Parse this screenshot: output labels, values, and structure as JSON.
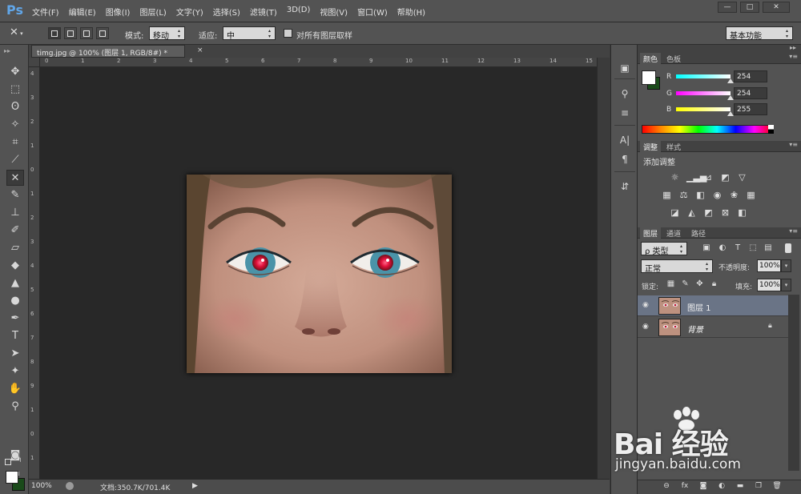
{
  "app": {
    "logo": "Ps",
    "menu": [
      "文件(F)",
      "编辑(E)",
      "图像(I)",
      "图层(L)",
      "文字(Y)",
      "选择(S)",
      "滤镜(T)",
      "3D(D)",
      "视图(V)",
      "窗口(W)",
      "帮助(H)"
    ],
    "window_controls": [
      "—",
      "□",
      "✕"
    ]
  },
  "options": {
    "mode_label": "模式:",
    "mode_value": "移动",
    "adapt_label": "适应:",
    "adapt_value": "中",
    "sample_all_label": "对所有图层取样",
    "workspace": "基本功能"
  },
  "document": {
    "tab_title": "timg.jpg @ 100% (图层 1, RGB/8#) *",
    "tab_close": "×",
    "zoom": "100%",
    "doc_info": "文档:350.7K/701.4K"
  },
  "rulers": {
    "h_ticks": [
      "0",
      "1",
      "2",
      "3",
      "4",
      "5",
      "6",
      "7",
      "8",
      "9",
      "10",
      "11",
      "12",
      "13",
      "14",
      "15"
    ],
    "v_ticks": [
      "4",
      "3",
      "2",
      "1",
      "0",
      "1",
      "2",
      "3",
      "4",
      "5",
      "6",
      "7",
      "8",
      "9",
      "1",
      "0",
      "1"
    ]
  },
  "tools": [
    {
      "name": "move-tool-icon",
      "glyph": "✥"
    },
    {
      "name": "marquee-tool-icon",
      "glyph": "⬚"
    },
    {
      "name": "lasso-tool-icon",
      "glyph": "ʘ"
    },
    {
      "name": "magic-wand-tool-icon",
      "glyph": "✧"
    },
    {
      "name": "crop-tool-icon",
      "glyph": "⌗"
    },
    {
      "name": "eyedropper-tool-icon",
      "glyph": "⟋"
    },
    {
      "name": "red-eye-tool-icon",
      "glyph": "✕"
    },
    {
      "name": "brush-tool-icon",
      "glyph": "✎"
    },
    {
      "name": "stamp-tool-icon",
      "glyph": "⊥"
    },
    {
      "name": "history-brush-tool-icon",
      "glyph": "✐"
    },
    {
      "name": "eraser-tool-icon",
      "glyph": "▱"
    },
    {
      "name": "paint-bucket-tool-icon",
      "glyph": "◆"
    },
    {
      "name": "blur-tool-icon",
      "glyph": "▲"
    },
    {
      "name": "dodge-tool-icon",
      "glyph": "●"
    },
    {
      "name": "pen-tool-icon",
      "glyph": "✒"
    },
    {
      "name": "type-tool-icon",
      "glyph": "T"
    },
    {
      "name": "path-select-tool-icon",
      "glyph": "➤"
    },
    {
      "name": "shape-tool-icon",
      "glyph": "✦"
    },
    {
      "name": "hand-tool-icon",
      "glyph": "✋"
    },
    {
      "name": "zoom-tool-icon",
      "glyph": "⚲"
    }
  ],
  "color_panel": {
    "tabs": [
      "颜色",
      "色板"
    ],
    "channels": [
      {
        "label": "R",
        "value": "254",
        "gradient": "linear-gradient(to right,#00ffff,#ffffff)"
      },
      {
        "label": "G",
        "value": "254",
        "gradient": "linear-gradient(to right,#ff00ff,#ffffff)"
      },
      {
        "label": "B",
        "value": "255",
        "gradient": "linear-gradient(to right,#ffff00,#ffffff)"
      }
    ],
    "fg_color": "#ffffff",
    "bg_color": "#1a4a1a"
  },
  "adjustments_panel": {
    "tabs": [
      "调整",
      "样式"
    ],
    "title": "添加调整"
  },
  "layers_panel": {
    "tabs": [
      "图层",
      "通道",
      "路径"
    ],
    "filter": "ρ 类型",
    "blend_mode": "正常",
    "opacity_label": "不透明度:",
    "opacity": "100%",
    "lock_label": "锁定:",
    "fill_label": "填充:",
    "fill": "100%",
    "layers": [
      {
        "name": "图层 1",
        "selected": true,
        "locked": false
      },
      {
        "name": "背景",
        "selected": false,
        "locked": true
      }
    ]
  },
  "watermark": {
    "text": "Bai 经验",
    "url": "jingyan.baidu.com"
  }
}
